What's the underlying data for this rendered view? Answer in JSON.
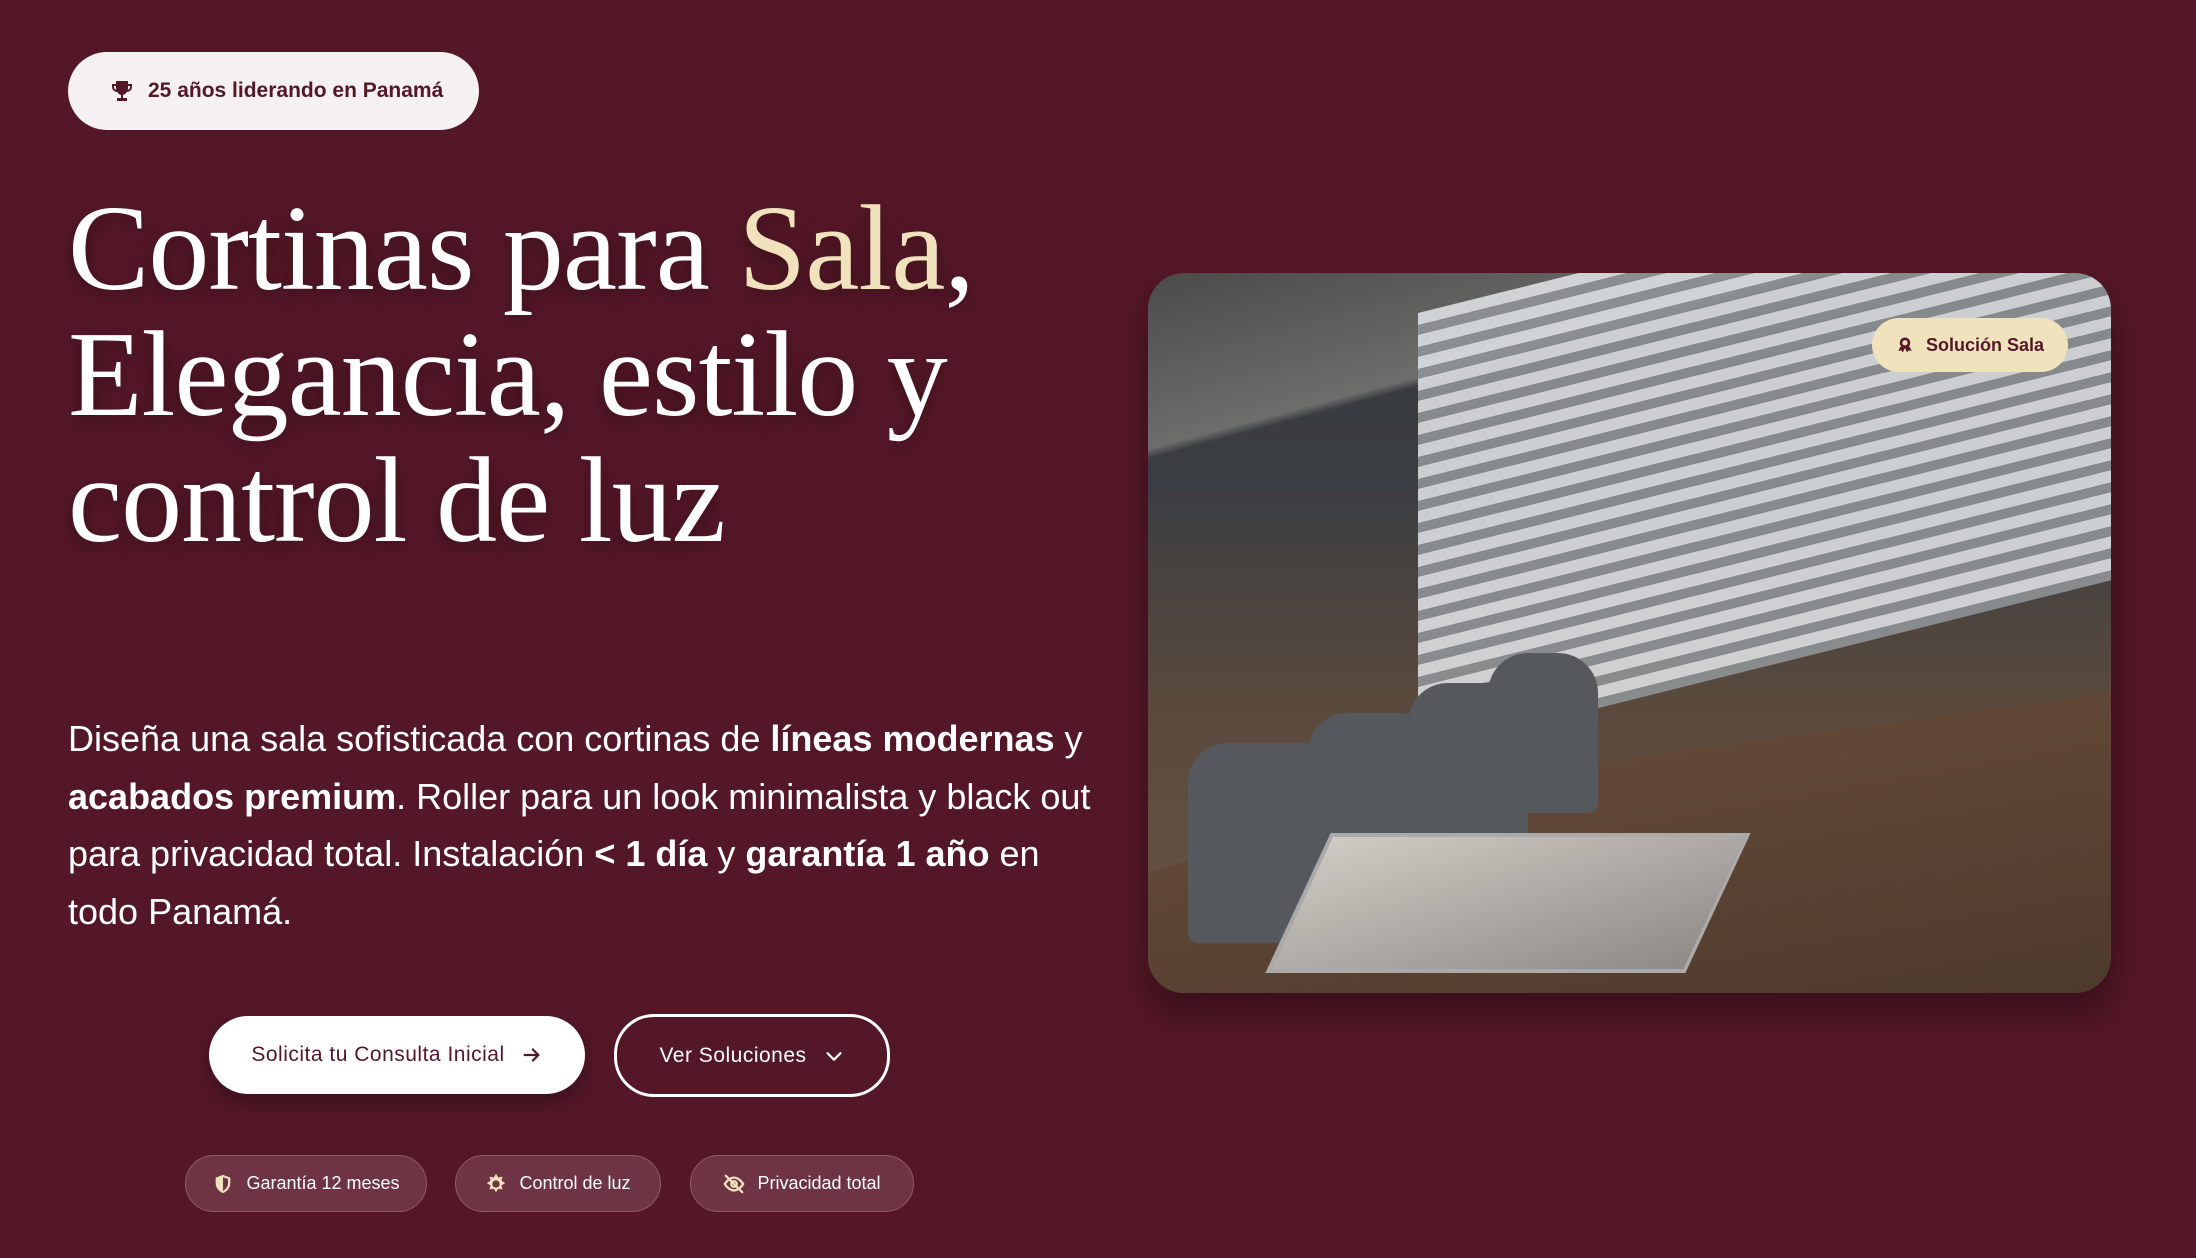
{
  "badge": {
    "icon": "trophy-icon",
    "label": "25 años liderando en Panamá"
  },
  "headline": {
    "part1": "Cortinas para ",
    "highlight": "Sala",
    "part2": ",",
    "line2": "Elegancia, estilo y",
    "line3": "control de luz",
    "highlight_color": "#f1e2be"
  },
  "description": {
    "t1": "Diseña una sala sofisticada con cortinas de ",
    "b1": "líneas modernas",
    "t2": " y ",
    "b2": "acabados premium",
    "t3": ". Roller para un look minimalista y black out para privacidad total. Instalación ",
    "b3": "< 1 día",
    "t4": " y ",
    "b4": "garantía 1 año",
    "t5": " en todo Panamá."
  },
  "buttons": {
    "primary": "Solicita tu Consulta Inicial",
    "secondary": "Ver Soluciones"
  },
  "features": [
    {
      "icon": "shield-icon",
      "label": "Garantía 12 meses"
    },
    {
      "icon": "sun-icon",
      "label": "Control de luz"
    },
    {
      "icon": "eye-off-icon",
      "label": "Privacidad total"
    }
  ],
  "photo": {
    "badge": "Solución Sala"
  },
  "colors": {
    "background": "#541727",
    "accent": "#f1e2be"
  }
}
